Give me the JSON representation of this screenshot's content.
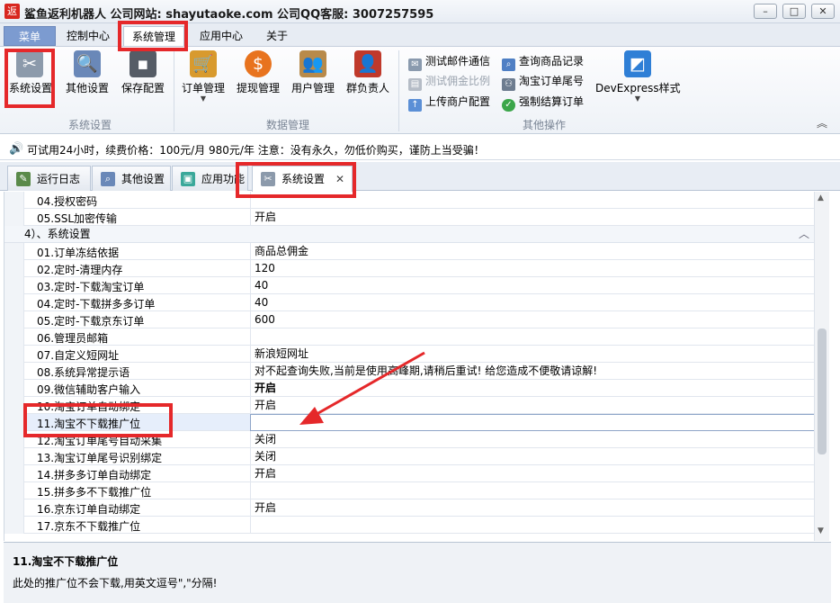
{
  "window": {
    "app_icon": "返",
    "title": "鲨鱼返利机器人  公司网站: shayutaoke.com 公司QQ客服: 3007257595",
    "controls": [
      "–",
      "□",
      "✕"
    ]
  },
  "menu_tabs": [
    "菜单",
    "控制中心",
    "系统管理",
    "应用中心",
    "关于"
  ],
  "ribbon": {
    "group_system": {
      "label": "系统设置",
      "buttons": [
        "系统设置",
        "其他设置",
        "保存配置"
      ]
    },
    "group_data": {
      "label": "数据管理",
      "buttons": [
        "订单管理",
        "提现管理",
        "用户管理",
        "群负责人"
      ]
    },
    "group_other": {
      "label": "其他操作",
      "small_buttons": [
        "测试邮件通信",
        "测试佣金比例",
        "上传商户配置",
        "查询商品记录",
        "淘宝订单尾号",
        "强制结算订单"
      ],
      "devexpress": "DevExpress样式"
    },
    "collapse_glyph": "︽"
  },
  "notice": "可试用24小时，续费价格：100元/月  980元/年   注意：没有永久，勿低价购买，谨防上当受骗！",
  "doc_tabs": [
    "运行日志",
    "其他设置",
    "应用功能",
    "系统设置"
  ],
  "doc_tab_close": "✕",
  "grid": {
    "top_rows": [
      {
        "name": "04.授权密码",
        "value": ""
      },
      {
        "name": "05.SSL加密传输",
        "value": "开启"
      }
    ],
    "category": "4）、系统设置",
    "category_chevron": "︿",
    "rows": [
      {
        "name": "01.订单冻结依据",
        "value": "商品总佣金"
      },
      {
        "name": "02.定时-清理内存",
        "value": "120"
      },
      {
        "name": "03.定时-下载淘宝订单",
        "value": "40"
      },
      {
        "name": "04.定时-下载拼多多订单",
        "value": "40"
      },
      {
        "name": "05.定时-下载京东订单",
        "value": "600"
      },
      {
        "name": "06.管理员邮箱",
        "value": ""
      },
      {
        "name": "07.自定义短网址",
        "value": "新浪短网址"
      },
      {
        "name": "08.系统异常提示语",
        "value": "对不起查询失败,当前是使用高峰期,请稍后重试! 给您造成不便敬请谅解!"
      },
      {
        "name": "09.微信辅助客户输入",
        "value": "开启"
      },
      {
        "name": "10.淘宝订单自动绑定",
        "value": "开启"
      },
      {
        "name": "11.淘宝不下载推广位",
        "value": ""
      },
      {
        "name": "12.淘宝订单尾号自动采集",
        "value": "关闭"
      },
      {
        "name": "13.淘宝订单尾号识别绑定",
        "value": "关闭"
      },
      {
        "name": "14.拼多多订单自动绑定",
        "value": "开启"
      },
      {
        "name": "15.拼多多不下载推广位",
        "value": ""
      },
      {
        "name": "16.京东订单自动绑定",
        "value": "开启"
      },
      {
        "name": "17.京东不下载推广位",
        "value": ""
      }
    ]
  },
  "scrollbar": {
    "up": "▲",
    "down": "▼"
  },
  "description": {
    "title": "11.淘宝不下载推广位",
    "text": "此处的推广位不会下载,用英文逗号\",\"分隔!"
  },
  "colors": {
    "highlight": "#e5282a",
    "menu_tab_bg": "#7c9bd0",
    "notice_icon": "#2f9a2f"
  },
  "icons": {
    "system_settings": "tools-icon",
    "other_settings": "document-search-icon",
    "save_config": "save-disk-icon",
    "order_mgmt": "shopping-cart-icon",
    "withdraw_mgmt": "dollar-coin-icon",
    "user_mgmt": "users-icon",
    "group_leader": "person-icon",
    "devexpress": "devexpress-logo-icon"
  }
}
